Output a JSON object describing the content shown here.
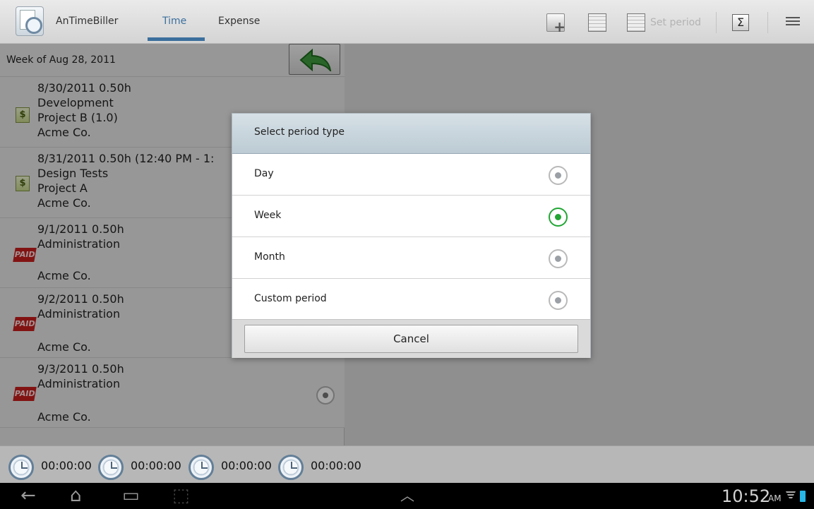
{
  "app": {
    "title": "AnTimeBiller"
  },
  "tabs": [
    {
      "label": "Time",
      "active": true
    },
    {
      "label": "Expense",
      "active": false
    }
  ],
  "actionbar": {
    "icons": [
      "add-entry-icon",
      "calendar-icon",
      "calendar-set-icon",
      "sigma-icon",
      "overflow-menu-icon"
    ],
    "set_period_label": "Set period"
  },
  "week": {
    "label": "Week of Aug 28, 2011"
  },
  "entries": [
    {
      "lines": [
        "8/30/2011 0.50h",
        "Development",
        "Project B (1.0)",
        "Acme Co."
      ],
      "badge": "$"
    },
    {
      "lines": [
        "8/31/2011 0.50h (12:40 PM - 1:",
        "Design Tests",
        "Project A",
        "Acme Co."
      ],
      "badge": "$"
    },
    {
      "lines": [
        "9/1/2011 0.50h",
        "Administration",
        "",
        "Acme Co."
      ],
      "badge": "PAID"
    },
    {
      "lines": [
        "9/2/2011 0.50h",
        "Administration",
        "",
        "Acme Co."
      ],
      "badge": "PAID"
    },
    {
      "lines": [
        "9/3/2011 0.50h",
        "Administration",
        "",
        "Acme Co."
      ],
      "badge": "PAID"
    }
  ],
  "timers": [
    "00:00:00",
    "00:00:00",
    "00:00:00",
    "00:00:00"
  ],
  "dialog": {
    "title": "Select period type",
    "options": [
      {
        "label": "Day",
        "selected": false
      },
      {
        "label": "Week",
        "selected": true
      },
      {
        "label": "Month",
        "selected": false
      },
      {
        "label": "Custom period",
        "selected": false
      }
    ],
    "cancel_label": "Cancel"
  },
  "system": {
    "time": "10:52",
    "ampm": "AM",
    "nav_icons": [
      "back-icon",
      "home-icon",
      "recent-apps-icon",
      "screenshot-icon",
      "menu-up-icon"
    ]
  },
  "colors": {
    "accent": "#3b6f9d",
    "selected_radio": "#22a634",
    "paid": "#c81e1e"
  }
}
